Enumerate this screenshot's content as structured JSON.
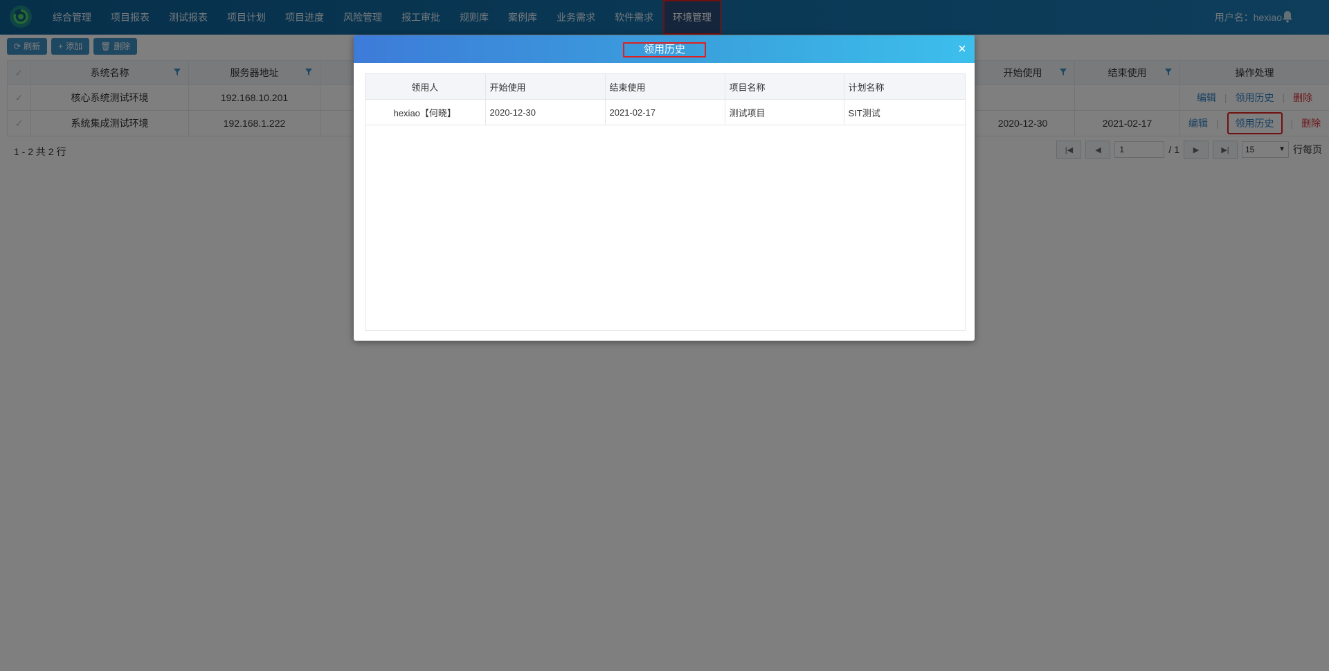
{
  "nav": {
    "items": [
      "综合管理",
      "项目报表",
      "测试报表",
      "项目计划",
      "项目进度",
      "风险管理",
      "报工审批",
      "规则库",
      "案例库",
      "业务需求",
      "软件需求",
      "环境管理"
    ],
    "user": "用户名：hexiao"
  },
  "toolbar": {
    "refresh": "刷新",
    "add": "添加",
    "delete": "删除"
  },
  "grid": {
    "headers": {
      "system": "系统名称",
      "server": "服务器地址",
      "start": "开始使用",
      "end": "结束使用",
      "ops": "操作处理"
    },
    "rows": [
      {
        "system": "核心系统测试环境",
        "server": "192.168.10.201",
        "start": "",
        "end": ""
      },
      {
        "system": "系统集成测试环境",
        "server": "192.168.1.222",
        "start": "2020-12-30",
        "end": "2021-02-17"
      }
    ],
    "actions": {
      "edit": "编辑",
      "history": "领用历史",
      "delete": "删除"
    }
  },
  "pager": {
    "summary": "1 - 2 共 2 行",
    "page": "1",
    "total": "/ 1",
    "per_page": "15",
    "per_page_label": "行每页"
  },
  "modal": {
    "title": "领用历史",
    "close": "×",
    "headers": [
      "领用人",
      "开始使用",
      "结束使用",
      "项目名称",
      "计划名称"
    ],
    "rows": [
      [
        "hexiao【何晓】",
        "2020-12-30",
        "2021-02-17",
        "测试项目",
        "SIT测试"
      ]
    ]
  }
}
